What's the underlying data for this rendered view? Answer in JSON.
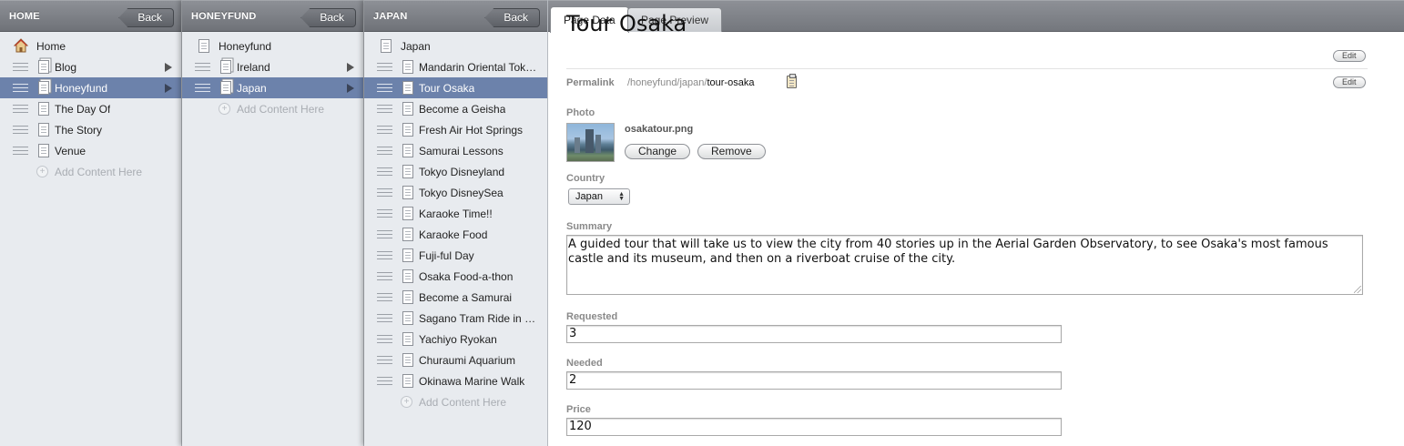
{
  "columns": [
    {
      "title": "HOME",
      "back_label": "Back",
      "items": [
        {
          "label": "Home",
          "icon": "home-icon"
        },
        {
          "label": "Blog",
          "icon": "doc-stack-icon",
          "has_children": true
        },
        {
          "label": "Honeyfund",
          "icon": "doc-stack-icon",
          "has_children": true,
          "selected": true
        },
        {
          "label": "The Day Of",
          "icon": "document-icon"
        },
        {
          "label": "The Story",
          "icon": "document-icon"
        },
        {
          "label": "Venue",
          "icon": "document-icon"
        }
      ],
      "add_label": "Add Content Here"
    },
    {
      "title": "HONEYFUND",
      "back_label": "Back",
      "items": [
        {
          "label": "Honeyfund",
          "icon": "document-icon"
        },
        {
          "label": "Ireland",
          "icon": "doc-stack-icon",
          "has_children": true
        },
        {
          "label": "Japan",
          "icon": "doc-stack-icon",
          "has_children": true,
          "selected": true
        }
      ],
      "add_label": "Add Content Here"
    },
    {
      "title": "JAPAN",
      "back_label": "Back",
      "items": [
        {
          "label": "Japan",
          "icon": "document-icon"
        },
        {
          "label": "Mandarin Oriental Tok…",
          "icon": "document-icon"
        },
        {
          "label": "Tour Osaka",
          "icon": "document-icon",
          "selected": true
        },
        {
          "label": "Become a Geisha",
          "icon": "document-icon"
        },
        {
          "label": "Fresh Air Hot Springs",
          "icon": "document-icon"
        },
        {
          "label": "Samurai Lessons",
          "icon": "document-icon"
        },
        {
          "label": "Tokyo Disneyland",
          "icon": "document-icon"
        },
        {
          "label": "Tokyo DisneySea",
          "icon": "document-icon"
        },
        {
          "label": "Karaoke Time!!",
          "icon": "document-icon"
        },
        {
          "label": "Karaoke Food",
          "icon": "document-icon"
        },
        {
          "label": "Fuji-ful Day",
          "icon": "document-icon"
        },
        {
          "label": "Osaka Food-a-thon",
          "icon": "document-icon"
        },
        {
          "label": "Become a Samurai",
          "icon": "document-icon"
        },
        {
          "label": "Sagano Tram Ride in …",
          "icon": "document-icon"
        },
        {
          "label": "Yachiyo Ryokan",
          "icon": "document-icon"
        },
        {
          "label": "Churaumi Aquarium",
          "icon": "document-icon"
        },
        {
          "label": "Okinawa Marine Walk",
          "icon": "document-icon"
        }
      ],
      "add_label": "Add Content Here"
    }
  ],
  "tabs": {
    "page_data": "Page Data",
    "page_preview": "Page Preview"
  },
  "detail": {
    "title": "Tour Osaka",
    "edit_label": "Edit",
    "permalink_label": "Permalink",
    "permalink_prefix": "/honeyfund/japan/",
    "permalink_slug": "tour-osaka",
    "photo_label": "Photo",
    "photo_filename": "osakatour.png",
    "change_label": "Change",
    "remove_label": "Remove",
    "country_label": "Country",
    "country_value": "Japan",
    "summary_label": "Summary",
    "summary_value": "A guided tour that will take us to view the city from 40 stories up in the Aerial Garden Observatory, to see Osaka's most famous castle and its museum, and then on a riverboat cruise of the city.",
    "requested_label": "Requested",
    "requested_value": "3",
    "needed_label": "Needed",
    "needed_value": "2",
    "price_label": "Price",
    "price_value": "120"
  },
  "colors": {
    "selected_row": "#6c82ab",
    "header": "#7c7f85",
    "column_bg": "#e8ebef"
  }
}
